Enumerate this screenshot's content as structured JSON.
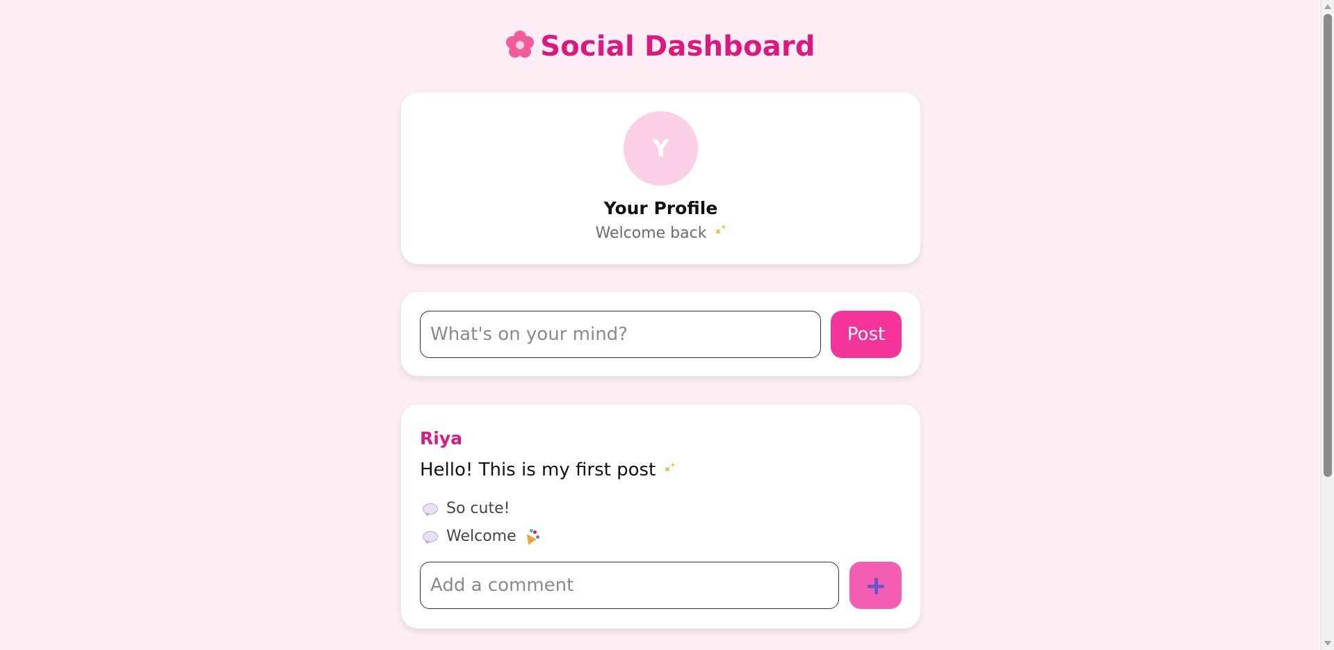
{
  "app": {
    "title": "Social Dashboard",
    "logo_icon": "cherry-blossom-icon",
    "accent_color": "#e0167f"
  },
  "profile": {
    "avatar_initial": "Y",
    "name": "Your Profile",
    "subtitle": "Welcome back"
  },
  "composer": {
    "placeholder": "What's on your mind?",
    "value": "",
    "post_label": "Post"
  },
  "posts": [
    {
      "author": "Riya",
      "body": "Hello! This is my first post",
      "comments": [
        {
          "text": "So cute!",
          "icon": "speech-bubble-icon"
        },
        {
          "text": "Welcome",
          "icon": "speech-bubble-icon",
          "trailing_icon": "party-popper-icon"
        }
      ],
      "comment_placeholder": "Add a comment",
      "comment_value": "",
      "comment_button_icon": "plus-icon"
    }
  ]
}
